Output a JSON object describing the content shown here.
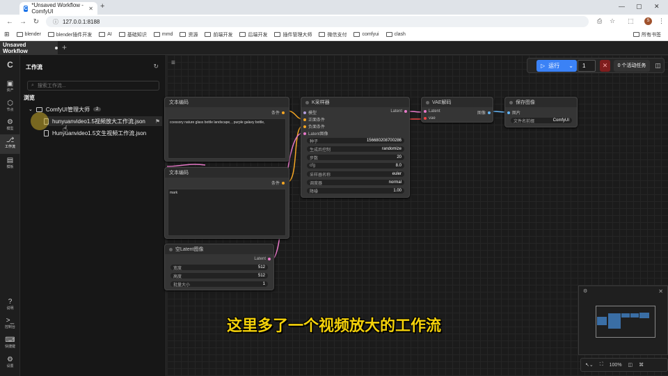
{
  "browser": {
    "tab_title": "*Unsaved Workflow - ComfyUI",
    "url": "127.0.0.1:8188",
    "bookmarks": [
      "blender",
      "blender插件开发",
      "AI",
      "基础知识",
      "mmd",
      "资源",
      "前端开发",
      "后端开发",
      "插件管理大师",
      "微信支付",
      "comfyui",
      "clash"
    ],
    "all_bookmarks": "所有书签"
  },
  "workflow_tab": {
    "title": "Unsaved Workflow"
  },
  "iconbar": {
    "items": [
      {
        "label": "资产",
        "icon": "image-icon"
      },
      {
        "label": "节点",
        "icon": "node-icon"
      },
      {
        "label": "模型",
        "icon": "model-icon"
      },
      {
        "label": "工作流",
        "icon": "workflow-icon"
      },
      {
        "label": "模板",
        "icon": "template-icon"
      }
    ],
    "bottom": [
      {
        "label": "说明",
        "icon": "help-icon"
      },
      {
        "label": "控制台",
        "icon": "terminal-icon"
      },
      {
        "label": "快捷键",
        "icon": "keyboard-icon"
      },
      {
        "label": "设置",
        "icon": "settings-icon"
      }
    ]
  },
  "sidebar": {
    "title": "工作流",
    "search_placeholder": "搜索工作流...",
    "browse": "浏览",
    "folder": {
      "name": "ComfyUI管理大师",
      "count": "2"
    },
    "files": [
      "hunyuanvideo1.5视频放大工作流.json",
      "Hunyuanvideo1.5文生视频工作流.json"
    ]
  },
  "nodes": {
    "text_enc1": {
      "title": "文本编码",
      "output": "条件",
      "text": "ccessory nature glass bottle landscape, , purple galaxy bottle,"
    },
    "text_enc2": {
      "title": "文本编码",
      "output": "条件",
      "text": "mark"
    },
    "empty_latent": {
      "title": "空Latent图像",
      "output": "Latent",
      "widgets": [
        {
          "label": "宽度",
          "value": "512"
        },
        {
          "label": "高度",
          "value": "512"
        },
        {
          "label": "批量大小",
          "value": "1"
        }
      ]
    },
    "ksampler": {
      "title": "K采样器",
      "inputs": [
        "模型",
        "正面条件",
        "负面条件",
        "Latent图像"
      ],
      "output": "Latent",
      "widgets": [
        {
          "label": "种子",
          "value": "156680208700286"
        },
        {
          "label": "生成后控制",
          "value": "randomize"
        },
        {
          "label": "步数",
          "value": "20"
        },
        {
          "label": "cfg",
          "value": "8.0"
        },
        {
          "label": "采样器名称",
          "value": "euler"
        },
        {
          "label": "调度器",
          "value": "normal"
        },
        {
          "label": "降噪",
          "value": "1.00"
        }
      ]
    },
    "vae_decode": {
      "title": "VAE解码",
      "inputs": [
        "Latent",
        "vae"
      ],
      "output": "图像"
    },
    "save_image": {
      "title": "保存图像",
      "input": "图片",
      "widget": {
        "label": "文件名前缀",
        "value": "ComfyUI"
      }
    }
  },
  "run_panel": {
    "run": "运行",
    "count": "1",
    "tasks": "0 个活动任务"
  },
  "zoom": {
    "level": "100%"
  },
  "subtitle": "这里多了一个视频放大的工作流",
  "colors": {
    "accent": "#3b82f6",
    "subtitle": "#f5d20a",
    "cond": "#f5a623",
    "latent": "#e879c9",
    "vae": "#ef4444",
    "image": "#64b5f6"
  }
}
